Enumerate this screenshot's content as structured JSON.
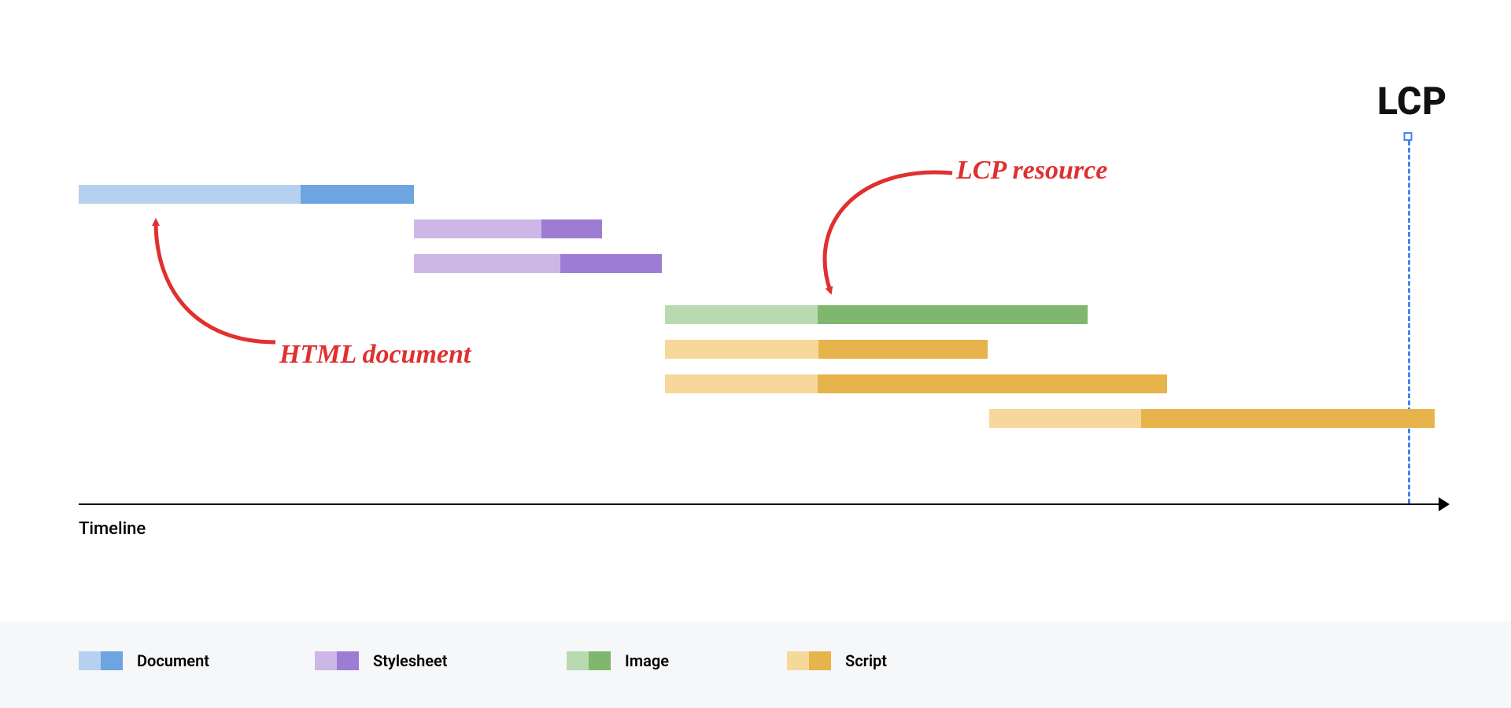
{
  "chart_data": {
    "type": "gantt",
    "xlabel": "Timeline",
    "xlim": [
      0,
      100
    ],
    "marker": {
      "label": "LCP",
      "x": 99
    },
    "annotations": [
      {
        "text": "HTML document",
        "target_bar_index": 0
      },
      {
        "text": "LCP resource",
        "target_bar_index": 3
      }
    ],
    "series": [
      {
        "type": "Document",
        "start": 0.0,
        "split": 16.2,
        "end": 24.5,
        "row": 0
      },
      {
        "type": "Stylesheet",
        "start": 24.5,
        "split": 33.8,
        "end": 38.2,
        "row": 1
      },
      {
        "type": "Stylesheet",
        "start": 24.5,
        "split": 35.2,
        "end": 42.6,
        "row": 2
      },
      {
        "type": "Image",
        "start": 42.8,
        "split": 54.0,
        "end": 73.7,
        "row": 3
      },
      {
        "type": "Script",
        "start": 42.8,
        "split": 54.0,
        "end": 66.4,
        "row": 4
      },
      {
        "type": "Script",
        "start": 42.8,
        "split": 54.0,
        "end": 79.5,
        "row": 5
      },
      {
        "type": "Script",
        "start": 66.5,
        "split": 77.6,
        "end": 99.0,
        "row": 6
      }
    ],
    "legend": [
      {
        "type": "Document",
        "label": "Document",
        "colorA": "#b6d0f0",
        "colorB": "#6ea5e0"
      },
      {
        "type": "Stylesheet",
        "label": "Stylesheet",
        "colorA": "#cdb7e6",
        "colorB": "#9d7dd4"
      },
      {
        "type": "Image",
        "label": "Image",
        "colorA": "#b9d9b0",
        "colorB": "#7fb76e"
      },
      {
        "type": "Script",
        "label": "Script",
        "colorA": "#f5d89a",
        "colorB": "#e6b44a"
      }
    ]
  }
}
